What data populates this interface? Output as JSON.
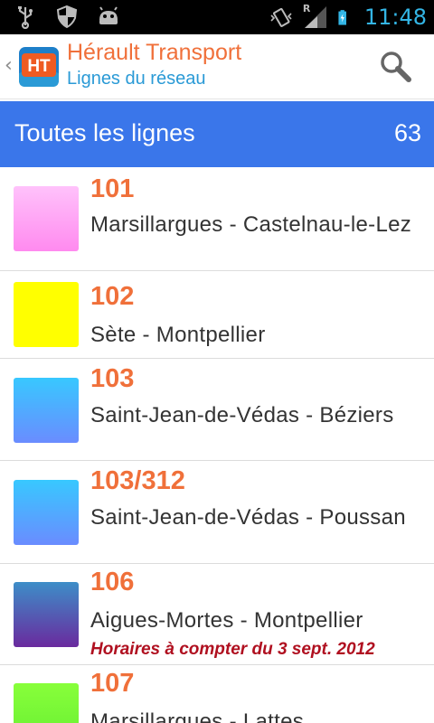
{
  "status_bar": {
    "time": "11:48",
    "icons_left": [
      "usb-icon",
      "shield-icon",
      "android-icon"
    ],
    "icons_right": [
      "vibrate-icon",
      "signal-icon",
      "battery-icon"
    ],
    "roaming": "R"
  },
  "action_bar": {
    "title": "Hérault Transport",
    "subtitle": "Lignes du réseau",
    "logo_text": "HT"
  },
  "header": {
    "title": "Toutes les lignes",
    "count": "63"
  },
  "lines": [
    {
      "number": "101",
      "name": "Marsillargues - Castelnau-le-Lez",
      "note": "",
      "color_top": "#ffc2fb",
      "color_bottom": "#ff8aef"
    },
    {
      "number": "102",
      "name": "Sète - Montpellier",
      "note": "",
      "color_top": "#ffff00",
      "color_bottom": "#ffff00"
    },
    {
      "number": "103",
      "name": "Saint-Jean-de-Védas - Béziers",
      "note": "",
      "color_top": "#38c8ff",
      "color_bottom": "#6a8cff"
    },
    {
      "number": "103/312",
      "name": "Saint-Jean-de-Védas - Poussan",
      "note": "",
      "color_top": "#38c8ff",
      "color_bottom": "#6a8cff"
    },
    {
      "number": "106",
      "name": "Aigues-Mortes - Montpellier",
      "note": "Horaires à compter du 3 sept. 2012",
      "color_top": "#3d8ec8",
      "color_bottom": "#6a2a9e"
    },
    {
      "number": "107",
      "name": "Marsillargues - Lattes",
      "note": "",
      "color_top": "#88ff3a",
      "color_bottom": "#66ee33"
    }
  ],
  "colors": {
    "accent_orange": "#f0703a",
    "accent_blue": "#2a9ad6",
    "header_blue": "#3a76ea",
    "note_red": "#b01020"
  }
}
